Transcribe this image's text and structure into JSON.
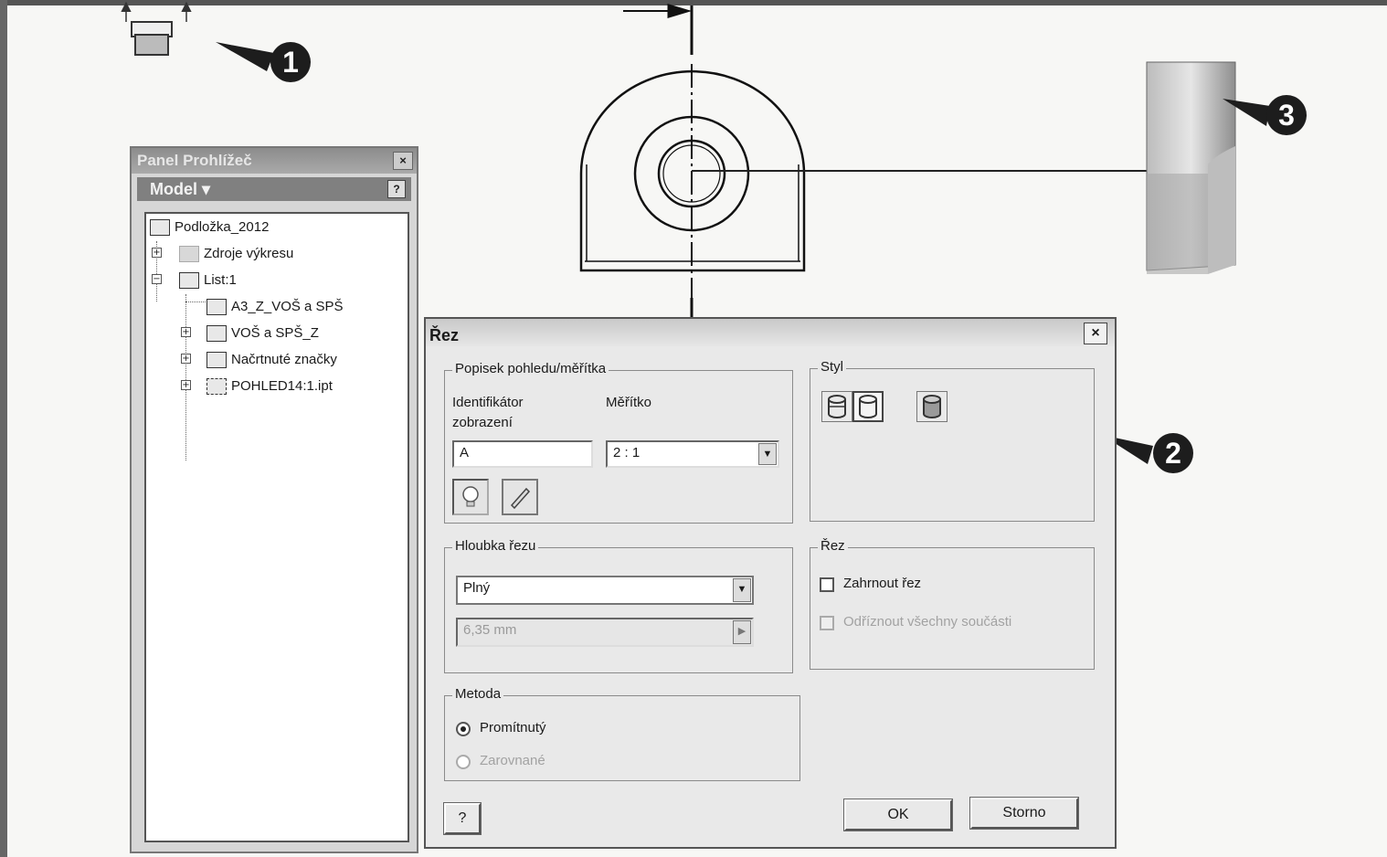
{
  "browser_panel": {
    "title": "Panel Prohlížeč",
    "model_label": "Model ▾",
    "help_label": "?",
    "close_label": "×",
    "tree": [
      {
        "label": "Podložka_2012"
      },
      {
        "label": "Zdroje výkresu"
      },
      {
        "label": "List:1"
      },
      {
        "label": "A3_Z_VOŠ a SPŠ"
      },
      {
        "label": "VOŠ a SPŠ_Z"
      },
      {
        "label": "Načrtnuté značky"
      },
      {
        "label": "POHLED14:1.ipt"
      }
    ]
  },
  "callouts": [
    "1",
    "2",
    "3"
  ],
  "dialog": {
    "title": "Řez",
    "close_label": "×",
    "view_label_group": {
      "title": "Popisek pohledu/měřítka",
      "identifier_label": "Identifikátor zobrazení",
      "identifier_value": "A",
      "scale_label": "Měřítko",
      "scale_value": "2 : 1"
    },
    "style_group": {
      "title": "Styl"
    },
    "depth_group": {
      "title": "Hloubka řezu",
      "depth_value": "Plný",
      "distance_value": "6,35 mm"
    },
    "section_group": {
      "title": "Řez",
      "include_slice": "Zahrnout řez",
      "slice_all_parts": "Odříznout všechny součásti"
    },
    "method_group": {
      "title": "Metoda",
      "projected": "Promítnutý",
      "aligned": "Zarovnané"
    },
    "help_label": "?",
    "ok_label": "OK",
    "cancel_label": "Storno"
  },
  "colors": {
    "dialog_bg": "#e9e9e9",
    "title_bar": "#c9c9c9",
    "panel_header": "#808080"
  }
}
